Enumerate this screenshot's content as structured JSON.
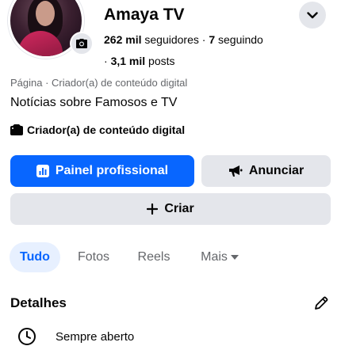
{
  "profile": {
    "name": "Amaya TV",
    "followers_count": "262 mil",
    "followers_label": "seguidores",
    "following_count": "7",
    "following_label": "seguindo",
    "posts_count": "3,1 mil",
    "posts_label": "posts",
    "category_line": "Página · Criador(a) de conteúdo digital",
    "bio": "Notícias sobre Famosos e TV",
    "creator_badge": "Criador(a) de conteúdo digital"
  },
  "actions": {
    "dashboard_label": "Painel profissional",
    "advertise_label": "Anunciar",
    "create_label": "Criar"
  },
  "tabs": [
    {
      "label": "Tudo",
      "active": true
    },
    {
      "label": "Fotos",
      "active": false
    },
    {
      "label": "Reels",
      "active": false
    },
    {
      "label": "Mais",
      "active": false
    }
  ],
  "details": {
    "title": "Detalhes",
    "hours": "Sempre aberto"
  },
  "colors": {
    "accent": "#0866ff",
    "button_gray": "#e4e6eb",
    "active_tab_bg": "#e7f0ff",
    "secondary_text": "#65676b"
  },
  "icons": [
    "camera-icon",
    "chevron-down-icon",
    "dashboard-icon",
    "megaphone-icon",
    "plus-icon",
    "caret-down-icon",
    "pencil-icon",
    "clock-icon",
    "creator-icon"
  ]
}
